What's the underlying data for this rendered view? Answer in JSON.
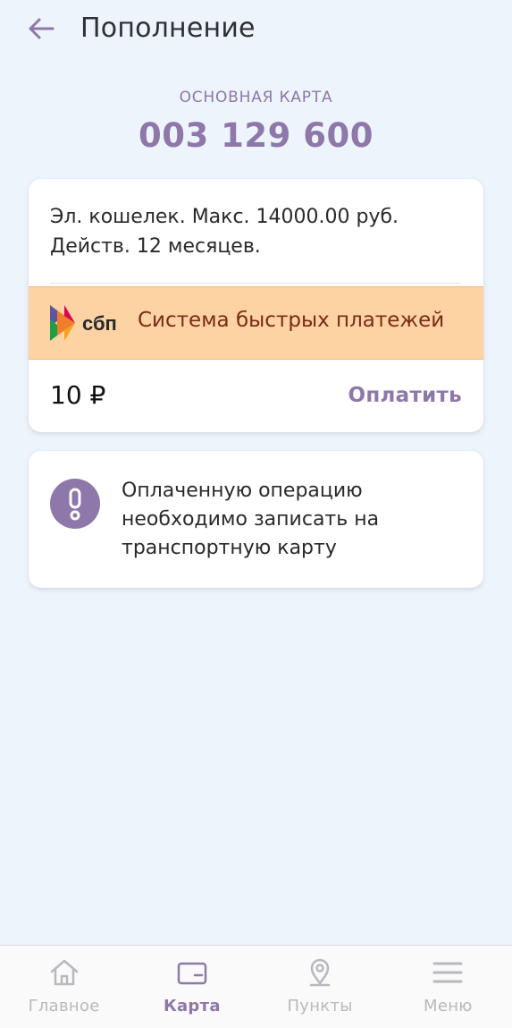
{
  "header": {
    "title": "Пополнение",
    "back_icon": "arrow-left-icon"
  },
  "card": {
    "label": "ОСНОВНАЯ КАРТА",
    "number": "003 129 600"
  },
  "tariff": {
    "description": "Эл. кошелек. Макс. 14000.00 руб. Действ. 12 месяцев.",
    "payment_method": {
      "logo_text": "сбп",
      "label": "Система быстрых платежей"
    },
    "amount": "10 ₽",
    "pay_label": "Оплатить"
  },
  "notice": {
    "icon": "exclamation-icon",
    "text": "Оплаченную операцию необходимо записать на транспортную карту"
  },
  "nav": {
    "items": [
      {
        "label": "Главное",
        "icon": "home-icon",
        "active": false
      },
      {
        "label": "Карта",
        "icon": "card-icon",
        "active": true
      },
      {
        "label": "Пункты",
        "icon": "location-pin-icon",
        "active": false
      },
      {
        "label": "Меню",
        "icon": "menu-icon",
        "active": false
      }
    ]
  },
  "colors": {
    "accent": "#8e77a9",
    "background": "#edf4fc",
    "sbp_highlight": "#fdd3a4",
    "sbp_text": "#7a2a18",
    "inactive_nav": "#b8b8bf"
  }
}
